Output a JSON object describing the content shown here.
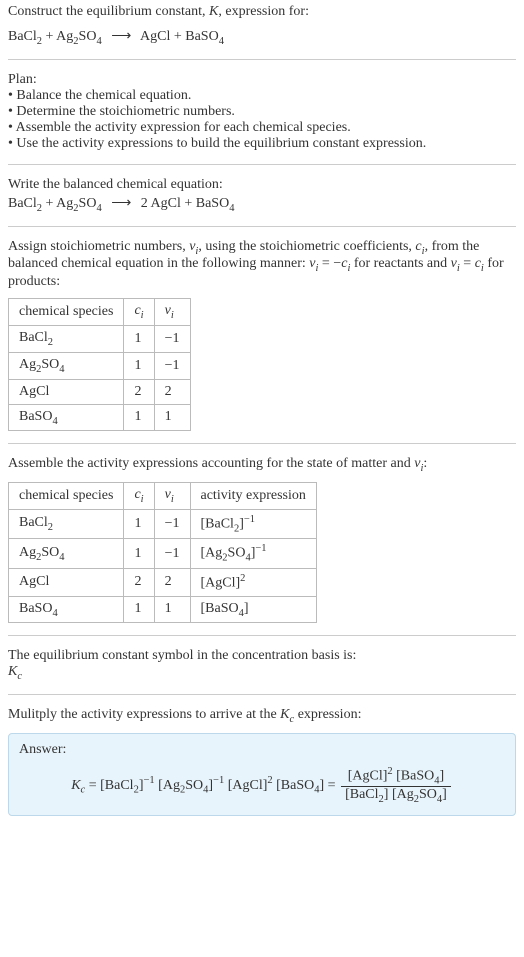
{
  "header": {
    "title_prefix": "Construct the equilibrium constant, ",
    "title_k": "K",
    "title_suffix": ", expression for:"
  },
  "reaction_unbalanced": {
    "r1_a": "BaCl",
    "r1_sub": "2",
    "plus1": " + ",
    "r2_a": "Ag",
    "r2_sub1": "2",
    "r2_b": "SO",
    "r2_sub2": "4",
    "arrow": "⟶",
    "p1": "AgCl",
    "plus2": " + ",
    "p2_a": "BaSO",
    "p2_sub": "4"
  },
  "plan": {
    "heading": "Plan:",
    "b1": "• Balance the chemical equation.",
    "b2": "• Determine the stoichiometric numbers.",
    "b3": "• Assemble the activity expression for each chemical species.",
    "b4": "• Use the activity expressions to build the equilibrium constant expression."
  },
  "balanced": {
    "heading": "Write the balanced chemical equation:",
    "r1_a": "BaCl",
    "r1_sub": "2",
    "plus1": " + ",
    "r2_a": "Ag",
    "r2_sub1": "2",
    "r2_b": "SO",
    "r2_sub2": "4",
    "arrow": "⟶",
    "p1_coef": "2 ",
    "p1": "AgCl",
    "plus2": " + ",
    "p2_a": "BaSO",
    "p2_sub": "4"
  },
  "assign": {
    "text_a": "Assign stoichiometric numbers, ",
    "nu": "ν",
    "nu_sub": "i",
    "text_b": ", using the stoichiometric coefficients, ",
    "c": "c",
    "c_sub": "i",
    "text_c": ", from the balanced chemical equation in the following manner: ",
    "eq1_l": "ν",
    "eq1_lsub": "i",
    "eq1_mid": " = −",
    "eq1_r": "c",
    "eq1_rsub": "i",
    "text_d": " for reactants and ",
    "eq2_l": "ν",
    "eq2_lsub": "i",
    "eq2_mid": " = ",
    "eq2_r": "c",
    "eq2_rsub": "i",
    "text_e": " for products:"
  },
  "table1": {
    "h1": "chemical species",
    "h2_a": "c",
    "h2_sub": "i",
    "h3_a": "ν",
    "h3_sub": "i",
    "rows": [
      {
        "sp_a": "BaCl",
        "sp_sub": "2",
        "c": "1",
        "nu": "−1"
      },
      {
        "sp_a": "Ag",
        "sp_sub1": "2",
        "sp_b": "SO",
        "sp_sub2": "4",
        "c": "1",
        "nu": "−1"
      },
      {
        "sp_a": "AgCl",
        "c": "2",
        "nu": "2"
      },
      {
        "sp_a": "BaSO",
        "sp_sub": "4",
        "c": "1",
        "nu": "1"
      }
    ]
  },
  "activity_intro": {
    "text_a": "Assemble the activity expressions accounting for the state of matter and ",
    "nu": "ν",
    "nu_sub": "i",
    "text_b": ":"
  },
  "table2": {
    "h1": "chemical species",
    "h2_a": "c",
    "h2_sub": "i",
    "h3_a": "ν",
    "h3_sub": "i",
    "h4": "activity expression",
    "rows": [
      {
        "sp_a": "BaCl",
        "sp_sub": "2",
        "c": "1",
        "nu": "−1",
        "ae_base_a": "[BaCl",
        "ae_base_sub": "2",
        "ae_base_b": "]",
        "ae_exp": "−1"
      },
      {
        "sp_a": "Ag",
        "sp_sub1": "2",
        "sp_b": "SO",
        "sp_sub2": "4",
        "c": "1",
        "nu": "−1",
        "ae_base_a": "[Ag",
        "ae_base_sub1": "2",
        "ae_base_b": "SO",
        "ae_base_sub2": "4",
        "ae_base_c": "]",
        "ae_exp": "−1"
      },
      {
        "sp_a": "AgCl",
        "c": "2",
        "nu": "2",
        "ae_base_a": "[AgCl]",
        "ae_exp": "2"
      },
      {
        "sp_a": "BaSO",
        "sp_sub": "4",
        "c": "1",
        "nu": "1",
        "ae_base_a": "[BaSO",
        "ae_base_sub": "4",
        "ae_base_b": "]"
      }
    ]
  },
  "conc_basis": {
    "line1": "The equilibrium constant symbol in the concentration basis is:",
    "kc_a": "K",
    "kc_sub": "c"
  },
  "multiply": {
    "text_a": "Mulitply the activity expressions to arrive at the ",
    "kc_a": "K",
    "kc_sub": "c",
    "text_b": " expression:"
  },
  "answer": {
    "label": "Answer:",
    "lhs_a": "K",
    "lhs_sub": "c",
    "eq": " = ",
    "t1_a": "[BaCl",
    "t1_sub": "2",
    "t1_b": "]",
    "t1_exp": "−1",
    "sp": " ",
    "t2_a": "[Ag",
    "t2_sub1": "2",
    "t2_b": "SO",
    "t2_sub2": "4",
    "t2_c": "]",
    "t2_exp": "−1",
    "t3_a": "[AgCl]",
    "t3_exp": "2",
    "t4_a": "[BaSO",
    "t4_sub": "4",
    "t4_b": "]",
    "eq2": " = ",
    "num_a": "[AgCl]",
    "num_exp": "2",
    "num_sp": " ",
    "num_b": "[BaSO",
    "num_bsub": "4",
    "num_c": "]",
    "den_a": "[BaCl",
    "den_asub": "2",
    "den_b": "] [Ag",
    "den_bsub1": "2",
    "den_c": "SO",
    "den_bsub2": "4",
    "den_d": "]"
  }
}
